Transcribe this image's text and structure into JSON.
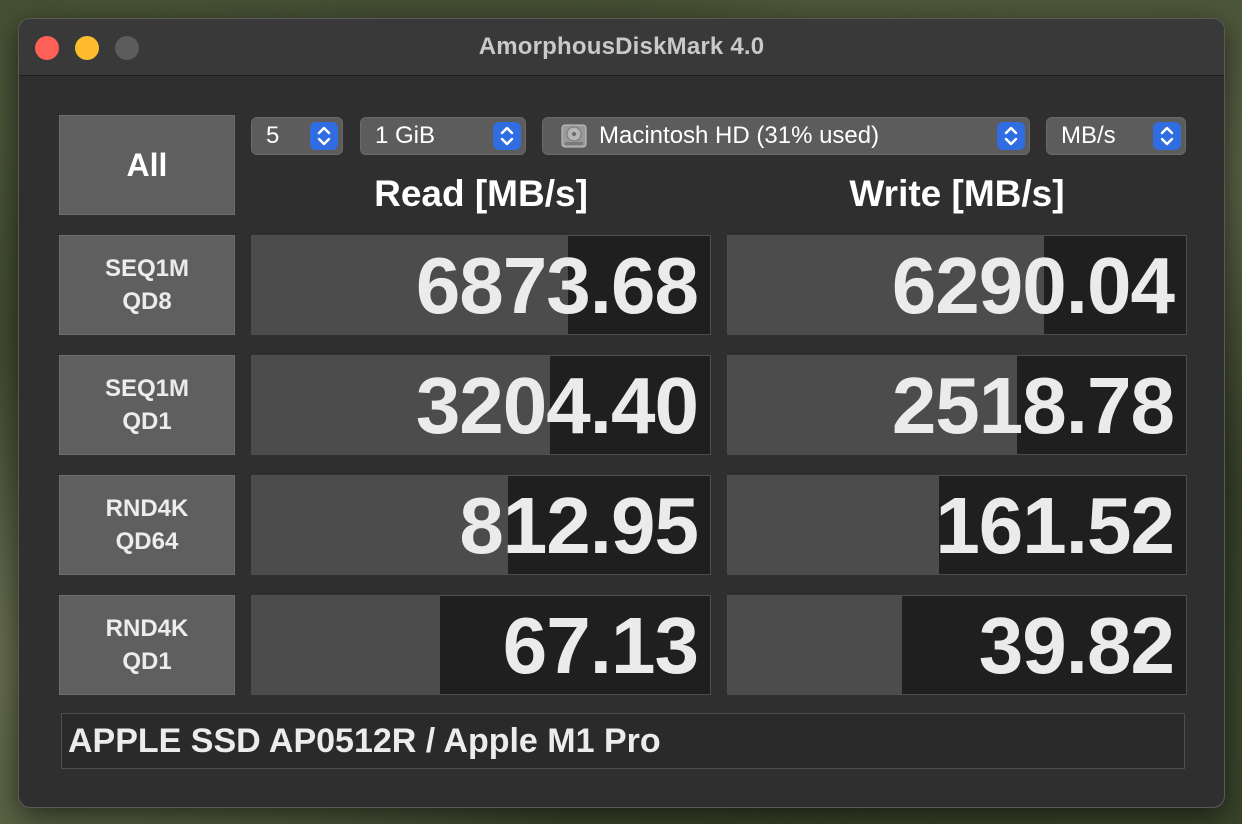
{
  "window": {
    "title": "AmorphousDiskMark 4.0"
  },
  "controls": {
    "all_label": "All",
    "count": "5",
    "size": "1 GiB",
    "drive": "Macintosh HD (31% used)",
    "unit": "MB/s"
  },
  "headers": {
    "read": "Read [MB/s]",
    "write": "Write [MB/s]"
  },
  "rows": [
    {
      "line1": "SEQ1M",
      "line2": "QD8",
      "read": "6873.68",
      "write": "6290.04",
      "read_fill": 0.69,
      "write_fill": 0.69
    },
    {
      "line1": "SEQ1M",
      "line2": "QD1",
      "read": "3204.40",
      "write": "2518.78",
      "read_fill": 0.65,
      "write_fill": 0.63
    },
    {
      "line1": "RND4K",
      "line2": "QD64",
      "read": "812.95",
      "write": "161.52",
      "read_fill": 0.56,
      "write_fill": 0.46
    },
    {
      "line1": "RND4K",
      "line2": "QD1",
      "read": "67.13",
      "write": "39.82",
      "read_fill": 0.41,
      "write_fill": 0.38
    }
  ],
  "status": "APPLE SSD AP0512R / Apple M1 Pro",
  "icons": {
    "updown": "chevron-updown-icon",
    "drive": "hard-drive-icon"
  },
  "colors": {
    "close": "#fe5f57",
    "minimize": "#febc2e",
    "zoom": "#5c5c5c",
    "accent": "#2f6de0"
  }
}
